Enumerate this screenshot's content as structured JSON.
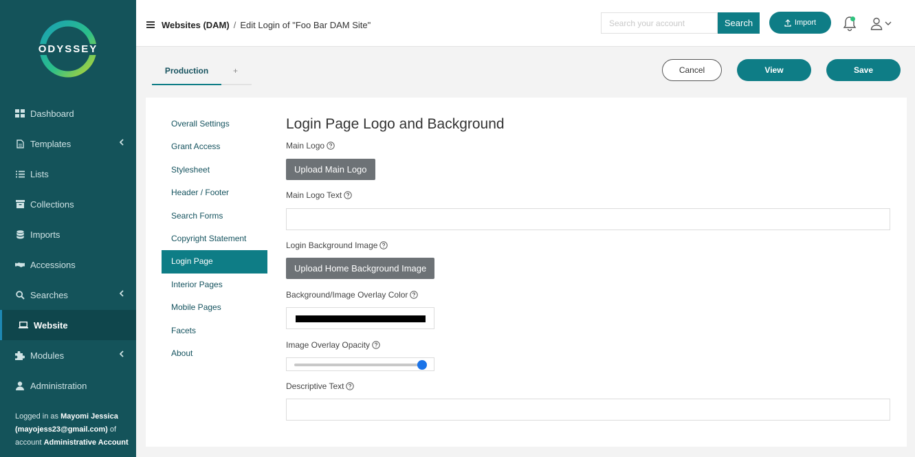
{
  "brand": {
    "name": "ODYSSEY"
  },
  "sidebar": {
    "items": [
      {
        "label": "Dashboard",
        "icon": "dashboard-icon",
        "chevron": false
      },
      {
        "label": "Templates",
        "icon": "document-icon",
        "chevron": true
      },
      {
        "label": "Lists",
        "icon": "list-icon",
        "chevron": false
      },
      {
        "label": "Collections",
        "icon": "archive-icon",
        "chevron": false
      },
      {
        "label": "Imports",
        "icon": "database-icon",
        "chevron": false
      },
      {
        "label": "Accessions",
        "icon": "handshake-icon",
        "chevron": false
      },
      {
        "label": "Searches",
        "icon": "search-icon",
        "chevron": true
      },
      {
        "label": "Website",
        "icon": "laptop-icon",
        "chevron": false,
        "active": true
      },
      {
        "label": "Modules",
        "icon": "puzzle-icon",
        "chevron": true
      },
      {
        "label": "Administration",
        "icon": "user-icon",
        "chevron": false
      }
    ],
    "logged_prefix": "Logged in as",
    "user_name": "Mayomi Jessica",
    "user_email": "(mayojess23@gmail.com)",
    "of_account": "of account",
    "account": "Administrative Account"
  },
  "header": {
    "breadcrumb_root": "Websites (DAM)",
    "breadcrumb_sep": "/",
    "breadcrumb_current": "Edit Login of \"Foo Bar DAM Site\"",
    "search_placeholder": "Search your account",
    "search_value": "",
    "search_label": "Search",
    "import_label": "Import"
  },
  "toolbar": {
    "tab_active": "Production",
    "tab_add": "+",
    "cancel_label": "Cancel",
    "view_label": "View",
    "save_label": "Save"
  },
  "subnav": {
    "items": [
      {
        "label": "Overall Settings"
      },
      {
        "label": "Grant Access"
      },
      {
        "label": "Stylesheet"
      },
      {
        "label": "Header / Footer"
      },
      {
        "label": "Search Forms"
      },
      {
        "label": "Copyright Statement"
      },
      {
        "label": "Login Page",
        "active": true
      },
      {
        "label": "Interior Pages"
      },
      {
        "label": "Mobile Pages"
      },
      {
        "label": "Facets"
      },
      {
        "label": "About"
      }
    ]
  },
  "form": {
    "title": "Login Page Logo and Background",
    "main_logo_label": "Main Logo",
    "upload_main_logo": "Upload Main Logo",
    "main_logo_text_label": "Main Logo Text",
    "main_logo_text_value": "",
    "bg_image_label": "Login Background Image",
    "upload_bg": "Upload Home Background Image",
    "overlay_color_label": "Background/Image Overlay Color",
    "overlay_color_value": "#000000",
    "opacity_label": "Image Overlay Opacity",
    "opacity_value": 1.0,
    "descriptive_text_label": "Descriptive Text",
    "descriptive_text_value": ""
  },
  "colors": {
    "sidebar": "#14535a",
    "accent": "#0e7d86",
    "upload_button": "#6d7276",
    "slider_thumb": "#1a73e8"
  }
}
